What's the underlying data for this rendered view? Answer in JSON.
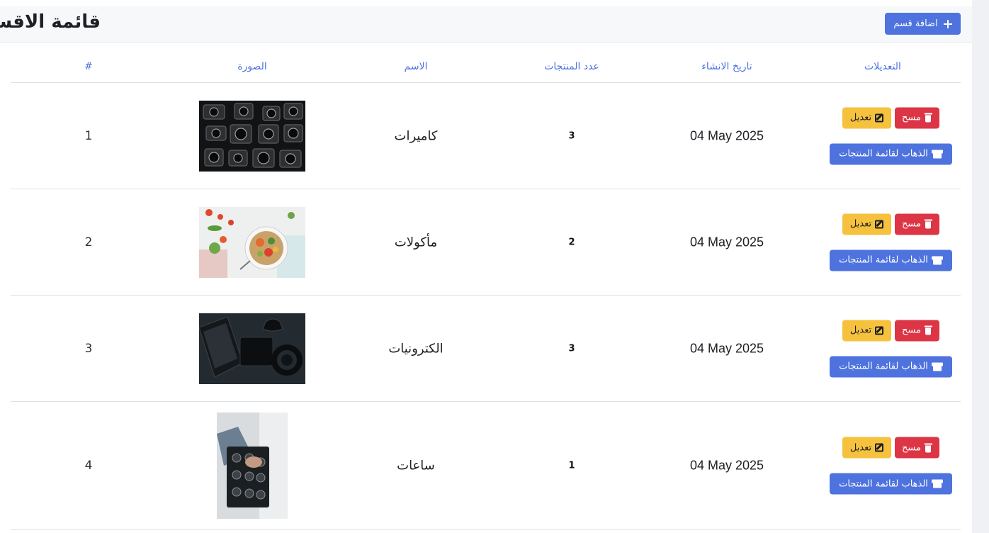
{
  "header": {
    "title": "قائمة الاقسام",
    "add_button_label": "اضافة قسم"
  },
  "table": {
    "columns": {
      "index": "#",
      "image": "الصورة",
      "name": "الاسم",
      "count": "عدد المنتجات",
      "created": "تاريخ الانشاء",
      "actions": "التعديلات"
    },
    "rows": [
      {
        "index": "1",
        "name": "كاميرات",
        "count": "3",
        "date": "04 May 2025",
        "image_icon": "cameras-photo-icon"
      },
      {
        "index": "2",
        "name": "مأكولات",
        "count": "2",
        "date": "04 May 2025",
        "image_icon": "food-photo-icon"
      },
      {
        "index": "3",
        "name": "الكترونيات",
        "count": "3",
        "date": "04 May 2025",
        "image_icon": "electronics-photo-icon"
      },
      {
        "index": "4",
        "name": "ساعات",
        "count": "1",
        "date": "04 May 2025",
        "image_icon": "watches-photo-icon"
      }
    ],
    "actions": {
      "delete_label": "مسح",
      "edit_label": "تعديل",
      "go_label": "الذهاب لقائمة المنتجات"
    }
  },
  "colors": {
    "primary": "#4e73df",
    "danger": "#dc3545",
    "warning": "#f6c23e"
  }
}
